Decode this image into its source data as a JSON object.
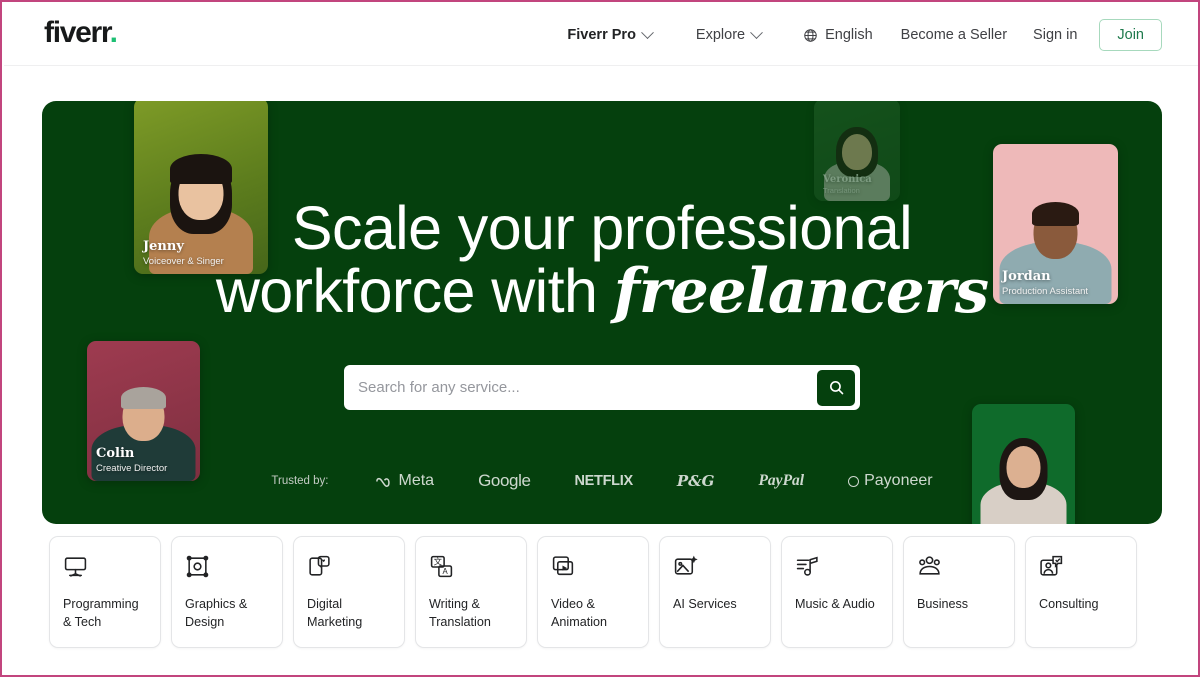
{
  "brand": {
    "logo_text": "fiverr",
    "logo_dot": ".",
    "accent_green": "#1dbf73",
    "hero_green": "#05400d",
    "page_border": "#c2457e"
  },
  "header": {
    "nav": [
      {
        "label": "Fiverr Pro",
        "icon": "chevron-down-icon",
        "has_chevron": true
      },
      {
        "label": "Explore",
        "icon": "chevron-down-icon",
        "has_chevron": true
      },
      {
        "label": "English",
        "icon": "globe-icon",
        "has_chevron": false
      },
      {
        "label": "Become a Seller",
        "icon": "",
        "has_chevron": false
      },
      {
        "label": "Sign in",
        "icon": "",
        "has_chevron": false
      }
    ],
    "join_label": "Join"
  },
  "hero": {
    "headline_line1": "Scale your professional",
    "headline_line2_prefix": "workforce with ",
    "headline_line2_italic": "freelancers",
    "search": {
      "placeholder": "Search for any service...",
      "value": "",
      "button_icon": "search-icon"
    },
    "trusted": {
      "label": "Trusted by:",
      "brands": [
        "Meta",
        "Google",
        "NETFLIX",
        "P&G",
        "PayPal",
        "Payoneer"
      ]
    },
    "freelancers": [
      {
        "name": "Jenny",
        "role": "Voiceover & Singer"
      },
      {
        "name": "Veronica",
        "role": "Translation"
      },
      {
        "name": "Jordan",
        "role": "Production Assistant"
      },
      {
        "name": "Colin",
        "role": "Creative Director"
      },
      {
        "name": "",
        "role": ""
      }
    ]
  },
  "categories": [
    {
      "label": "Programming\n& Tech",
      "icon": "monitor-icon"
    },
    {
      "label": "Graphics &\nDesign",
      "icon": "design-frame-icon"
    },
    {
      "label": "Digital\nMarketing",
      "icon": "megaphone-phone-icon"
    },
    {
      "label": "Writing &\nTranslation",
      "icon": "translate-icon"
    },
    {
      "label": "Video &\nAnimation",
      "icon": "video-layers-icon"
    },
    {
      "label": "AI Services",
      "icon": "ai-image-icon"
    },
    {
      "label": "Music & Audio",
      "icon": "music-note-icon"
    },
    {
      "label": "Business",
      "icon": "people-group-icon"
    },
    {
      "label": "Consulting",
      "icon": "consulting-chat-icon"
    }
  ]
}
